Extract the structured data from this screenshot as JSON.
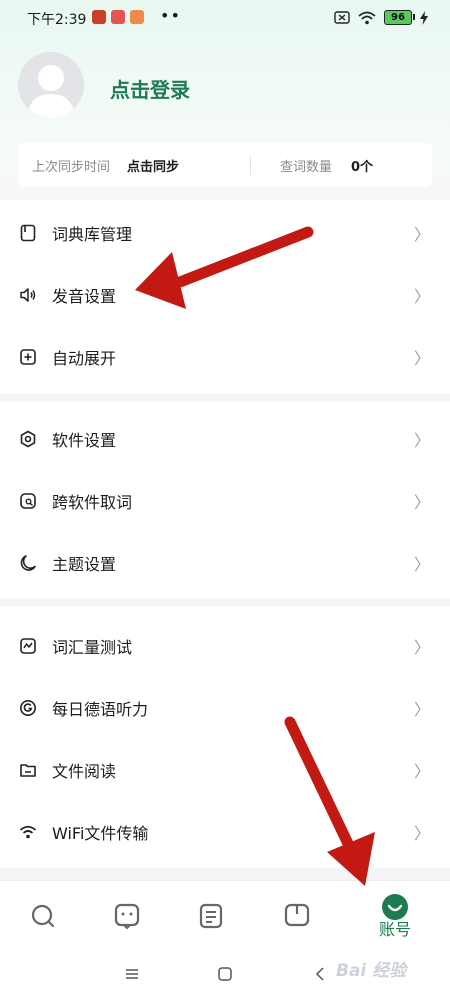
{
  "status_bar": {
    "time": "下午2:39",
    "dots": "••",
    "battery": "96"
  },
  "profile": {
    "login_label": "点击登录"
  },
  "sync": {
    "last_sync_label": "上次同步时间",
    "sync_action": "点击同步",
    "lookup_count_label": "查词数量",
    "lookup_count_value": "0个"
  },
  "menu": {
    "group1": [
      {
        "label": "词典库管理",
        "icon": "book-icon"
      },
      {
        "label": "发音设置",
        "icon": "speaker-icon"
      },
      {
        "label": "自动展开",
        "icon": "plus-box-icon"
      }
    ],
    "group2": [
      {
        "label": "软件设置",
        "icon": "hexagon-icon"
      },
      {
        "label": "跨软件取词",
        "icon": "search-box-icon"
      },
      {
        "label": "主题设置",
        "icon": "moon-icon"
      }
    ],
    "group3": [
      {
        "label": "词汇量测试",
        "icon": "wave-icon"
      },
      {
        "label": "每日德语听力",
        "icon": "german-icon"
      },
      {
        "label": "文件阅读",
        "icon": "folder-icon"
      },
      {
        "label": "WiFi文件传输",
        "icon": "wifi-icon"
      }
    ],
    "chevron": "〉"
  },
  "bottom_nav": {
    "account_label": "账号"
  },
  "watermark": "Bai 经验",
  "colors": {
    "brand_green": "#1e7a4f",
    "arrow_red": "#c21a12"
  }
}
